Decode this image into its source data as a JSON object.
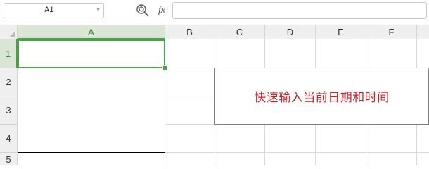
{
  "formula_bar": {
    "name_box_value": "A1",
    "name_box_dropdown_icon": "chevron-down-icon",
    "zoom_icon": "zoom-icon",
    "fx_label": "fx",
    "formula_value": ""
  },
  "grid": {
    "column_headers": [
      "A",
      "B",
      "C",
      "D",
      "E",
      "F"
    ],
    "row_headers": [
      "1",
      "2",
      "3",
      "4",
      "5"
    ],
    "selected_column": "A",
    "selected_row": "1",
    "active_cell": "A1",
    "bordered_range": "A1:A4",
    "corner_icon": "select-all-icon"
  },
  "textbox": {
    "text": "快速输入当前日期和时间"
  },
  "colors": {
    "selection_accent": "#4aa14a",
    "textbox_text": "#c0282d",
    "header_background": "#efefef"
  }
}
